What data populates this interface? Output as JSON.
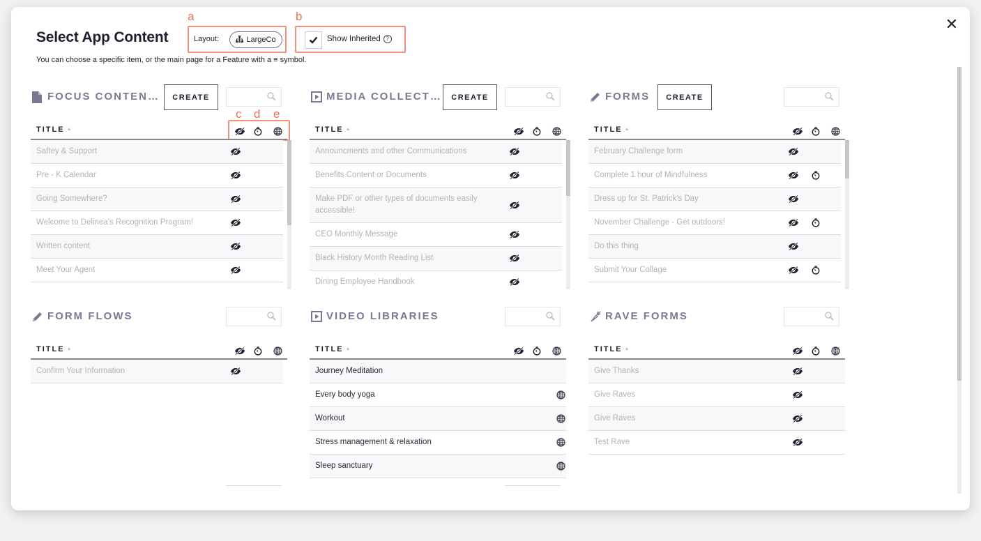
{
  "modal": {
    "title": "Select App Content",
    "subtitle": "You can choose a specific item, or the main page for a Feature with a ≡ symbol.",
    "close_icon": "close-icon"
  },
  "annotations": {
    "a": "a",
    "b": "b",
    "c": "c",
    "d": "d",
    "e": "e",
    "color": "#e8715a"
  },
  "layout": {
    "label": "Layout:",
    "value": "LargeCo",
    "icon": "org-chart-icon"
  },
  "show_inherited": {
    "label": "Show Inherited",
    "checked": true,
    "help": "?"
  },
  "column_header": {
    "title": "TITLE",
    "sort": "▲",
    "icons": [
      "hidden-icon",
      "timer-icon",
      "globe-icon"
    ]
  },
  "create_label": "CREATE",
  "colors": {
    "heading": "#7b7892",
    "muted_text": "#b3b3b8",
    "dark_text": "#2a2838",
    "annotation": "#e8715a"
  },
  "panels": [
    {
      "id": "focus-content",
      "title": "FOCUS CONTEN…",
      "icon": "document-icon",
      "has_create": true,
      "rows": [
        {
          "title": "Saftey & Support",
          "hidden": true,
          "timer": false,
          "globe": false,
          "active": false
        },
        {
          "title": "Pre - K Calendar",
          "hidden": true,
          "timer": false,
          "globe": false,
          "active": false
        },
        {
          "title": "Going Somewhere?",
          "hidden": true,
          "timer": false,
          "globe": false,
          "active": false
        },
        {
          "title": "Welcome to Delinea's Recognition Program!",
          "hidden": true,
          "timer": false,
          "globe": false,
          "active": false
        },
        {
          "title": "Written content",
          "hidden": true,
          "timer": false,
          "globe": false,
          "active": false
        },
        {
          "title": "Meet Your Agent",
          "hidden": true,
          "timer": false,
          "globe": false,
          "active": false
        }
      ]
    },
    {
      "id": "media-collections",
      "title": "MEDIA COLLECT…",
      "icon": "play-box-icon",
      "has_create": true,
      "rows": [
        {
          "title": "Announcments and other Communications",
          "hidden": true,
          "timer": false,
          "globe": false,
          "active": false
        },
        {
          "title": "Benefits Content or Documents",
          "hidden": true,
          "timer": false,
          "globe": false,
          "active": false
        },
        {
          "title": "Make PDF or other types of documents easily accessible!",
          "hidden": true,
          "timer": false,
          "globe": false,
          "active": false
        },
        {
          "title": "CEO Monthly Message",
          "hidden": true,
          "timer": false,
          "globe": false,
          "active": false
        },
        {
          "title": "Black History Month Reading List",
          "hidden": true,
          "timer": false,
          "globe": false,
          "active": false
        },
        {
          "title": "Dining Employee Handbook",
          "hidden": true,
          "timer": false,
          "globe": false,
          "active": false
        }
      ]
    },
    {
      "id": "forms",
      "title": "FORMS",
      "icon": "pencil-icon",
      "has_create": true,
      "rows": [
        {
          "title": "February Challenge form",
          "hidden": true,
          "timer": false,
          "globe": false,
          "active": false
        },
        {
          "title": "Complete 1 hour of Mindfulness",
          "hidden": true,
          "timer": true,
          "globe": false,
          "active": false
        },
        {
          "title": "Dress up for St. Patrick's Day",
          "hidden": true,
          "timer": false,
          "globe": false,
          "active": false
        },
        {
          "title": "November Challenge - Get outdoors!",
          "hidden": true,
          "timer": true,
          "globe": false,
          "active": false
        },
        {
          "title": "Do this thing",
          "hidden": true,
          "timer": false,
          "globe": false,
          "active": false
        },
        {
          "title": "Submit Your Collage",
          "hidden": true,
          "timer": true,
          "globe": false,
          "active": false
        }
      ]
    },
    {
      "id": "form-flows",
      "title": "FORM FLOWS",
      "icon": "pencil-icon",
      "has_create": false,
      "rows": [
        {
          "title": "Confirm Your Information",
          "hidden": true,
          "timer": false,
          "globe": false,
          "active": false
        }
      ]
    },
    {
      "id": "video-libraries",
      "title": "VIDEO LIBRARIES",
      "icon": "play-box-icon",
      "has_create": false,
      "rows": [
        {
          "title": "Journey Meditation",
          "hidden": false,
          "timer": false,
          "globe": false,
          "active": true
        },
        {
          "title": "Every body yoga",
          "hidden": false,
          "timer": false,
          "globe": true,
          "active": true
        },
        {
          "title": "Workout",
          "hidden": false,
          "timer": false,
          "globe": true,
          "active": true
        },
        {
          "title": "Stress management & relaxation",
          "hidden": false,
          "timer": false,
          "globe": true,
          "active": true
        },
        {
          "title": "Sleep sanctuary",
          "hidden": false,
          "timer": false,
          "globe": true,
          "active": true
        }
      ]
    },
    {
      "id": "rave-forms",
      "title": "RAVE FORMS",
      "icon": "carrot-icon",
      "has_create": false,
      "rows": [
        {
          "title": "Give Thanks",
          "hidden": true,
          "timer": false,
          "globe": false,
          "active": false
        },
        {
          "title": "Give Raves",
          "hidden": true,
          "timer": false,
          "globe": false,
          "active": false
        },
        {
          "title": "Give Raves",
          "hidden": true,
          "timer": false,
          "globe": false,
          "active": false
        },
        {
          "title": "Test Rave",
          "hidden": true,
          "timer": false,
          "globe": false,
          "active": false
        }
      ]
    }
  ]
}
